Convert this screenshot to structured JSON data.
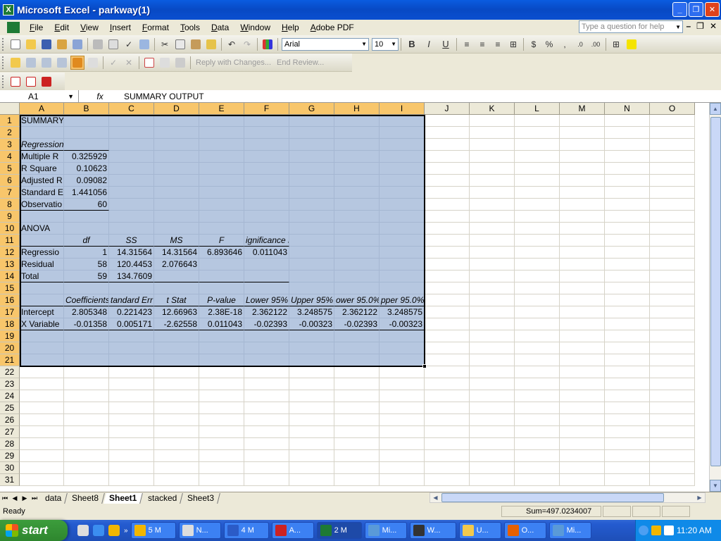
{
  "window": {
    "title": "Microsoft Excel - parkway(1)",
    "app_icon": "X"
  },
  "menu": [
    "File",
    "Edit",
    "View",
    "Insert",
    "Format",
    "Tools",
    "Data",
    "Window",
    "Help",
    "Adobe PDF"
  ],
  "help_placeholder": "Type a question for help",
  "font_name": "Arial",
  "font_size": "10",
  "review": {
    "reply": "Reply with Changes...",
    "end": "End Review..."
  },
  "name_box": "A1",
  "fx": "fx",
  "formula": "SUMMARY OUTPUT",
  "columns": [
    "A",
    "B",
    "C",
    "D",
    "E",
    "F",
    "G",
    "H",
    "I",
    "J",
    "K",
    "L",
    "M",
    "N",
    "O"
  ],
  "rows": [
    "1",
    "2",
    "3",
    "4",
    "5",
    "6",
    "7",
    "8",
    "9",
    "10",
    "11",
    "12",
    "13",
    "14",
    "15",
    "16",
    "17",
    "18",
    "19",
    "20",
    "21",
    "22",
    "23",
    "24",
    "25",
    "26",
    "27",
    "28",
    "29",
    "30",
    "31"
  ],
  "cells": {
    "r1": {
      "A": "SUMMARY OUTPUT"
    },
    "r3": {
      "A": "Regression Statistics"
    },
    "r4": {
      "A": "Multiple R",
      "B": "0.325929"
    },
    "r5": {
      "A": "R Square",
      "B": "0.10623"
    },
    "r6": {
      "A": "Adjusted R",
      "B": "0.09082"
    },
    "r7": {
      "A": "Standard E",
      "B": "1.441056"
    },
    "r8": {
      "A": "Observatio",
      "B": "60"
    },
    "r10": {
      "A": "ANOVA"
    },
    "r11": {
      "B": "df",
      "C": "SS",
      "D": "MS",
      "E": "F",
      "F": "ignificance F"
    },
    "r12": {
      "A": "Regressio",
      "B": "1",
      "C": "14.31564",
      "D": "14.31564",
      "E": "6.893646",
      "F": "0.011043"
    },
    "r13": {
      "A": "Residual",
      "B": "58",
      "C": "120.4453",
      "D": "2.076643"
    },
    "r14": {
      "A": "Total",
      "B": "59",
      "C": "134.7609"
    },
    "r16": {
      "B": "Coefficients",
      "C": "tandard Err",
      "D": "t Stat",
      "E": "P-value",
      "F": "Lower 95%",
      "G": "Upper 95%",
      "H": "ower 95.0%",
      "I": "pper 95.0%"
    },
    "r17": {
      "A": "Intercept",
      "B": "2.805348",
      "C": "0.221423",
      "D": "12.66963",
      "E": "2.38E-18",
      "F": "2.362122",
      "G": "3.248575",
      "H": "2.362122",
      "I": "3.248575"
    },
    "r18": {
      "A": "X Variable",
      "B": "-0.01358",
      "C": "0.005171",
      "D": "-2.62558",
      "E": "0.011043",
      "F": "-0.02393",
      "G": "-0.00323",
      "H": "-0.02393",
      "I": "-0.00323"
    }
  },
  "sheets": [
    "data",
    "Sheet8",
    "Sheet1",
    "stacked",
    "Sheet3"
  ],
  "active_sheet": "Sheet1",
  "status": {
    "ready": "Ready",
    "sum": "Sum=497.0234007"
  },
  "taskbar": {
    "start": "start",
    "tasks": [
      {
        "label": "5 M",
        "icon": "outlook-icon",
        "active": false
      },
      {
        "label": "N...",
        "icon": "notepad-icon",
        "active": false
      },
      {
        "label": "4 M",
        "icon": "word-icon",
        "active": false
      },
      {
        "label": "A...",
        "icon": "acrobat-icon",
        "active": false
      },
      {
        "label": "2 M",
        "icon": "excel-icon",
        "active": true
      },
      {
        "label": "Mi...",
        "icon": "minitab-icon",
        "active": false
      },
      {
        "label": "W...",
        "icon": "winamp-icon",
        "active": false
      },
      {
        "label": "U...",
        "icon": "folder-icon",
        "active": false
      },
      {
        "label": "O...",
        "icon": "firefox-icon",
        "active": false
      },
      {
        "label": "Mi...",
        "icon": "minitab-icon",
        "active": false
      }
    ],
    "clock": "11:20 AM"
  }
}
